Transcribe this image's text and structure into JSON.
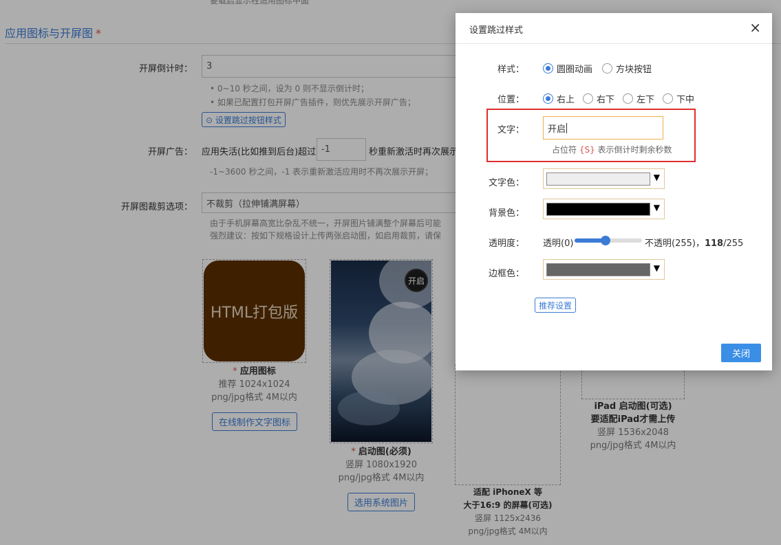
{
  "background": {
    "top_cut_text": "要载启显示柱适用图标中面",
    "section_title": "应用图标与开屏图",
    "required_star": "*",
    "countdown": {
      "label": "开屏倒计时：",
      "value": "3",
      "hints": [
        "• 0~10 秒之间，设为 0 则不显示倒计时；",
        "• 如果已配置打包开屏广告插件，则优先展示开屏广告；"
      ],
      "style_button": "⊙ 设置跳过按钮样式"
    },
    "splash_ad": {
      "label": "开屏广告：",
      "prefix": "应用失活(比如推到后台)超过",
      "value": "-1",
      "suffix": "秒重新激活时再次展示",
      "hint": "-1~3600 秒之间，-1 表示重新激活应用时不再次展示开屏；"
    },
    "crop": {
      "label": "开屏图裁剪选项：",
      "value": "不裁剪（拉伸铺满屏幕）",
      "hint1": "由于手机屏幕高宽比杂乱不统一，开屏图片铺满整个屏幕后可能",
      "hint2": "强烈建议：按如下规格设计上传两张启动图，如启用裁剪，请保"
    },
    "app_icon": {
      "icon_text": "HTML打包版",
      "req": "*",
      "title": "应用图标",
      "line1": "推荐 1024x1024",
      "line2": "png/jpg格式 4M以内",
      "button": "在线制作文字图标"
    },
    "launch_image": {
      "badge": "开启",
      "req": "*",
      "title": "启动图(必须)",
      "line1": "竖屏 1080x1920",
      "line2": "png/jpg格式 4M以内",
      "button": "选用系统图片"
    },
    "iphonex": {
      "title1": "适配 iPhoneX 等",
      "title2": "大于16:9 的屏幕(可选)",
      "line1": "竖屏 1125x2436",
      "line2": "png/jpg格式 4M以内"
    },
    "ipad": {
      "title1": "iPad 启动图(可选)",
      "title2": "要适配iPad才需上传",
      "line1": "竖屏 1536x2048",
      "line2": "png/jpg格式 4M以内"
    }
  },
  "dialog": {
    "title": "设置跳过样式",
    "close_glyph": "×",
    "style": {
      "label": "样式：",
      "options": [
        "圆圈动画",
        "方块按钮"
      ],
      "selected": 0
    },
    "position": {
      "label": "位置：",
      "options": [
        "右上",
        "右下",
        "左下",
        "下中"
      ],
      "selected": 0
    },
    "text": {
      "label": "文字：",
      "value": "开启",
      "hint_prefix": "占位符 ",
      "placeholder_token": "{S}",
      "hint_suffix": " 表示倒计时剩余秒数"
    },
    "text_color": {
      "label": "文字色：",
      "color": "#eeeeee"
    },
    "bg_color": {
      "label": "背景色：",
      "color": "#000000"
    },
    "opacity": {
      "label": "透明度：",
      "min_text": "透明(0)",
      "max_text": "不透明(255)，",
      "value": "118",
      "max": "/255",
      "fraction": 0.463
    },
    "border_color": {
      "label": "边框色：",
      "color": "#666666"
    },
    "recommend_button": "推荐设置",
    "close_button": "关闭"
  },
  "colors": {
    "accent": "#3a7bd5",
    "required": "#d9534f",
    "highlight": "#e02d2d",
    "app_icon_bg": "#5c3000"
  }
}
